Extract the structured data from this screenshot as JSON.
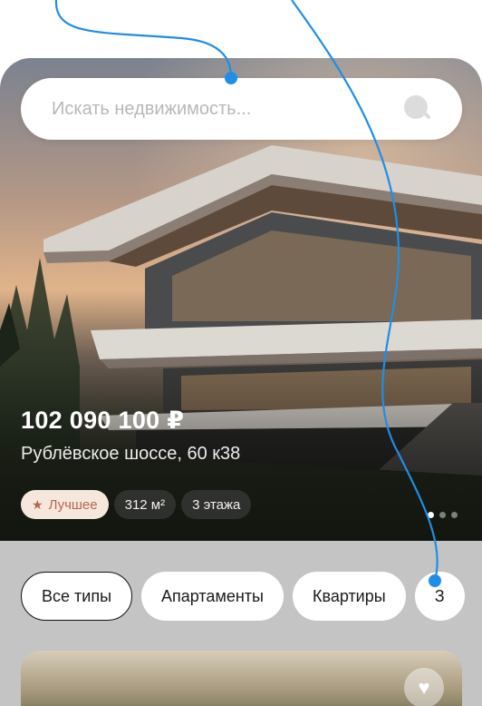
{
  "search": {
    "placeholder": "Искать недвижимость..."
  },
  "hero": {
    "price": "102 090 100 ₽",
    "address": "Рублёвское шоссе, 60 к38",
    "chips": [
      "Лучшее",
      "312 м²",
      "3 этажа"
    ],
    "carousel": {
      "total": 3,
      "active_index": 1
    }
  },
  "filters": [
    "Все типы",
    "Апартаменты",
    "Квартиры",
    "З"
  ],
  "active_filter": "Все типы",
  "colors": {
    "annotation": "#1f8ee6",
    "best_chip_bg": "#f6e7dc",
    "best_chip_text": "#b0684e",
    "band": "#c4c4c4"
  },
  "icons": [
    "search-icon",
    "star-icon",
    "heart-icon"
  ]
}
